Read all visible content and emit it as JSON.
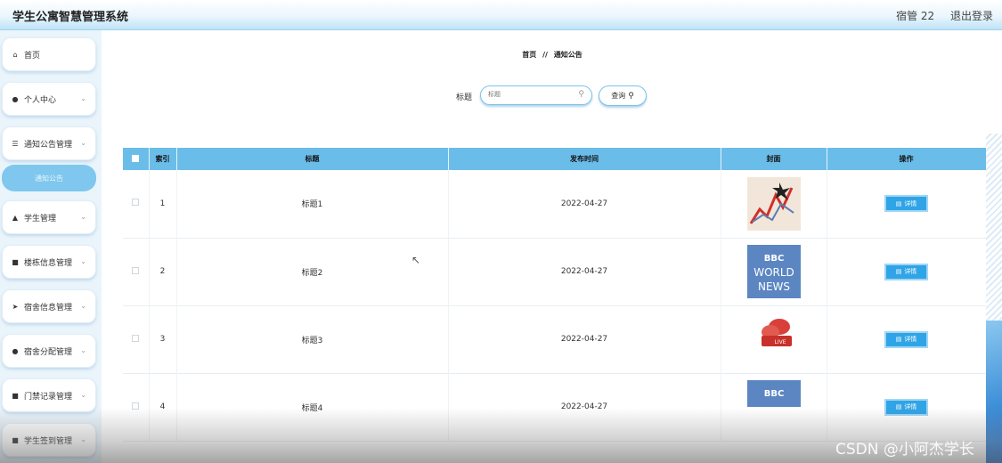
{
  "header": {
    "app_title": "学生公寓智慧管理系统",
    "user_label": "宿管 22",
    "logout_label": "退出登录"
  },
  "sidebar": {
    "items": [
      {
        "label": "首页",
        "icon": "home-icon",
        "glyph": "⌂",
        "expandable": false
      },
      {
        "label": "个人中心",
        "icon": "user-icon",
        "glyph": "●",
        "expandable": true
      },
      {
        "label": "通知公告管理",
        "icon": "list-icon",
        "glyph": "☰",
        "expandable": true
      },
      {
        "label": "学生管理",
        "icon": "thumb-icon",
        "glyph": "▲",
        "expandable": true
      },
      {
        "label": "楼栋信息管理",
        "icon": "grid-icon",
        "glyph": "■",
        "expandable": true
      },
      {
        "label": "宿舍信息管理",
        "icon": "send-icon",
        "glyph": "➤",
        "expandable": true
      },
      {
        "label": "宿舍分配管理",
        "icon": "user-icon",
        "glyph": "●",
        "expandable": true
      },
      {
        "label": "门禁记录管理",
        "icon": "grid-icon",
        "glyph": "■",
        "expandable": true
      },
      {
        "label": "学生签到管理",
        "icon": "grid-icon",
        "glyph": "■",
        "expandable": true
      }
    ],
    "active_submenu": "通知公告"
  },
  "breadcrumb": {
    "home": "首页",
    "separator": "//",
    "current": "通知公告"
  },
  "search": {
    "label": "标题",
    "placeholder": "标题",
    "button_label": "查询"
  },
  "table": {
    "columns": [
      "索引",
      "标题",
      "发布时间",
      "封面",
      "操作"
    ],
    "rows": [
      {
        "index": "1",
        "title": "标题1",
        "date": "2022-04-27",
        "cover": "chart-graphic"
      },
      {
        "index": "2",
        "title": "标题2",
        "date": "2022-04-27",
        "cover": "bbc-world-news"
      },
      {
        "index": "3",
        "title": "标题3",
        "date": "2022-04-27",
        "cover": "live-news-graphic"
      },
      {
        "index": "4",
        "title": "标题4",
        "date": "2022-04-27",
        "cover": "bbc-world-news"
      }
    ],
    "detail_label": "详情"
  },
  "cover_text": {
    "bbc": "BBC",
    "world": "WORLD",
    "news": "NEWS",
    "live": "LIVE"
  },
  "watermark": "CSDN @小阿杰学长",
  "colors": {
    "accent": "#6bbde9",
    "button": "#2fa4e6",
    "submenu_active": "#7fc7ee"
  }
}
